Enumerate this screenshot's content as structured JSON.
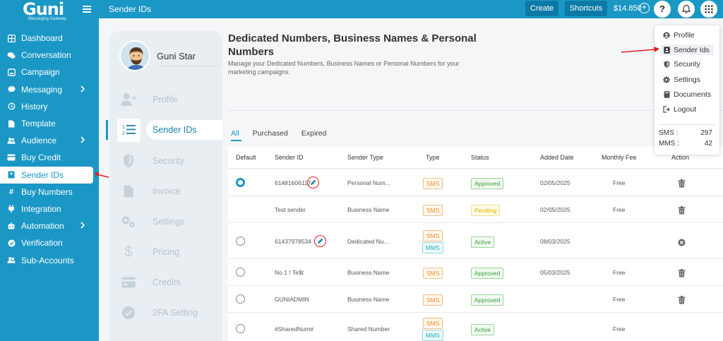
{
  "app": {
    "logo_text": "Guni",
    "logo_sub": "Messaging Gateway"
  },
  "sidebar": {
    "items": [
      {
        "label": "Dashboard",
        "icon": "grid-icon",
        "chevron": false
      },
      {
        "label": "Conversation",
        "icon": "chat-icon",
        "chevron": false
      },
      {
        "label": "Campaign",
        "icon": "inbox-icon",
        "chevron": false
      },
      {
        "label": "Messaging",
        "icon": "message-icon",
        "chevron": true
      },
      {
        "label": "History",
        "icon": "history-icon",
        "chevron": false
      },
      {
        "label": "Template",
        "icon": "file-icon",
        "chevron": false
      },
      {
        "label": "Audience",
        "icon": "users-icon",
        "chevron": true
      },
      {
        "label": "Buy Credit",
        "icon": "wallet-icon",
        "chevron": false
      },
      {
        "label": "Sender IDs",
        "icon": "id-card-icon",
        "chevron": false,
        "active": true
      },
      {
        "label": "Buy Numbers",
        "icon": "hash-icon",
        "chevron": false
      },
      {
        "label": "Integration",
        "icon": "plug-icon",
        "chevron": false
      },
      {
        "label": "Automation",
        "icon": "robot-icon",
        "chevron": true
      },
      {
        "label": "Verification",
        "icon": "check-circle-icon",
        "chevron": false
      },
      {
        "label": "Sub-Accounts",
        "icon": "users-icon",
        "chevron": false
      }
    ]
  },
  "topbar": {
    "page_title": "Sender IDs",
    "create_label": "Create",
    "shortcuts_label": "Shortcuts",
    "balance": "$14.850",
    "help_label": "?"
  },
  "profile": {
    "user_name": "Guni Star",
    "subnav": [
      {
        "label": "Profile",
        "icon": "user-plus-icon"
      },
      {
        "label": "Sender IDs",
        "icon": "list-ordered-icon",
        "active": true
      },
      {
        "label": "Security",
        "icon": "shield-icon"
      },
      {
        "label": "Invoice",
        "icon": "document-icon"
      },
      {
        "label": "Settings",
        "icon": "gears-icon"
      },
      {
        "label": "Pricing",
        "icon": "dollar-icon"
      },
      {
        "label": "Credits",
        "icon": "credit-card-icon"
      },
      {
        "label": "2FA Setting",
        "icon": "check-badge-icon"
      }
    ]
  },
  "main": {
    "title": "Dedicated Numbers, Business Names & Personal Numbers",
    "description": "Manage your Dedicated Numbers, Business Names or Personal Numbers for your marketing campaigns.",
    "tabs": [
      "All",
      "Purchased",
      "Expired"
    ],
    "columns": [
      "Default",
      "Sender ID",
      "Sender Type",
      "Type",
      "Status",
      "Added Date",
      "Monthly Fee",
      "Action"
    ],
    "rows": [
      {
        "default": "checked",
        "sender_id": "61481606117",
        "editable": true,
        "sender_type": "Personal Num...",
        "types": [
          "SMS"
        ],
        "status": "Approved",
        "added_date": "02/05/2025",
        "monthly_fee": "Free",
        "action": "delete"
      },
      {
        "default": "none",
        "sender_id": "Test sender",
        "editable": false,
        "sender_type": "Business Name",
        "types": [
          "SMS"
        ],
        "status": "Pending",
        "added_date": "02/05/2025",
        "monthly_fee": "Free",
        "action": "delete"
      },
      {
        "default": "unchecked",
        "sender_id": "61437978534",
        "editable": true,
        "sender_type": "Dedicated Nu...",
        "types": [
          "SMS",
          "MMS"
        ],
        "status": "Active",
        "added_date": "08/03/2025",
        "monthly_fee": "",
        "action": "cancel"
      },
      {
        "default": "unchecked",
        "sender_id": "No.1 ! Te$t",
        "editable": false,
        "sender_type": "Business Name",
        "types": [
          "SMS"
        ],
        "status": "Approved",
        "added_date": "05/03/2025",
        "monthly_fee": "Free",
        "action": "delete"
      },
      {
        "default": "unchecked",
        "sender_id": "GUNIADMIN",
        "editable": false,
        "sender_type": "Business Name",
        "types": [
          "SMS"
        ],
        "status": "Approved",
        "added_date": "",
        "monthly_fee": "Free",
        "action": "delete"
      },
      {
        "default": "unchecked",
        "sender_id": "#SharedNum#",
        "editable": false,
        "sender_type": "Shared Number",
        "types": [
          "SMS",
          "MMS"
        ],
        "status": "Active",
        "added_date": "",
        "monthly_fee": "Free",
        "action": ""
      }
    ]
  },
  "dropdown": {
    "items": [
      {
        "label": "Profile",
        "icon": "user-circle-icon"
      },
      {
        "label": "Sender Ids",
        "icon": "id-card-icon",
        "active": true
      },
      {
        "label": "Security",
        "icon": "shield-icon"
      },
      {
        "label": "Settings",
        "icon": "gear-icon"
      },
      {
        "label": "Documents",
        "icon": "book-icon"
      },
      {
        "label": "Logout",
        "icon": "logout-icon"
      }
    ],
    "sms_label": "SMS :",
    "sms_value": "297",
    "mms_label": "MMS :",
    "mms_value": "42"
  },
  "colors": {
    "primary": "#1b97c5",
    "annotation_red": "#e02020"
  }
}
